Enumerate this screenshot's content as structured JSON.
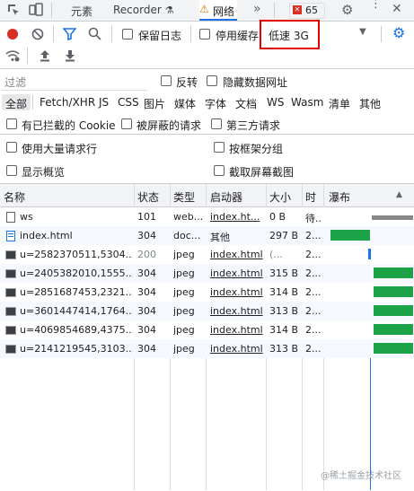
{
  "tabs": {
    "elements": "元素",
    "recorder": "Recorder",
    "network": "网络",
    "more": "»",
    "error_count": "65"
  },
  "toolbar": {
    "preserve_log": "保留日志",
    "disable_cache": "停用缓存",
    "throttling": "低速 3G"
  },
  "filter": {
    "placeholder": "过滤",
    "invert": "反转",
    "hide_data_urls": "隐藏数据网址",
    "types": [
      "全部",
      "Fetch/XHR",
      "JS",
      "CSS",
      "图片",
      "媒体",
      "字体",
      "文档",
      "WS",
      "Wasm",
      "清单",
      "其他"
    ],
    "blocked_cookies": "有已拦截的 Cookie",
    "blocked_requests": "被屏蔽的请求",
    "third_party": "第三方请求"
  },
  "settings": {
    "large_rows": "使用大量请求行",
    "group_by_frame": "按框架分组",
    "show_overview": "显示概览",
    "capture_screenshots": "截取屏幕截图"
  },
  "table": {
    "headers": [
      "名称",
      "状态",
      "类型",
      "启动器",
      "大小",
      "时",
      "瀑布"
    ],
    "rows": [
      {
        "name": "ws",
        "status": "101",
        "type": "web...",
        "initiator": "index.ht...",
        "size": "0 B",
        "time": "待...",
        "icon": "websocket-icon"
      },
      {
        "name": "index.html",
        "status": "304",
        "type": "doc...",
        "initiator": "其他",
        "size": "297 B",
        "time": "2...",
        "icon": "document-icon"
      },
      {
        "name": "u=2582370511,5304...",
        "status": "200",
        "type": "jpeg",
        "initiator": "index.html",
        "size": "(...",
        "time": "2...",
        "icon": "image-icon"
      },
      {
        "name": "u=2405382010,1555...",
        "status": "304",
        "type": "jpeg",
        "initiator": "index.html",
        "size": "315 B",
        "time": "2...",
        "icon": "image-icon"
      },
      {
        "name": "u=2851687453,2321...",
        "status": "304",
        "type": "jpeg",
        "initiator": "index.html",
        "size": "314 B",
        "time": "2...",
        "icon": "image-icon"
      },
      {
        "name": "u=3601447414,1764...",
        "status": "304",
        "type": "jpeg",
        "initiator": "index.html",
        "size": "313 B",
        "time": "2...",
        "icon": "image-icon"
      },
      {
        "name": "u=4069854689,4375...",
        "status": "304",
        "type": "jpeg",
        "initiator": "index.html",
        "size": "314 B",
        "time": "2...",
        "icon": "image-icon"
      },
      {
        "name": "u=2141219545,3103...",
        "status": "304",
        "type": "jpeg",
        "initiator": "index.html",
        "size": "313 B",
        "time": "2...",
        "icon": "image-icon"
      }
    ]
  },
  "watermark": "@稀土掘金技术社区",
  "colors": {
    "accent": "#1a73e8",
    "record": "#d93025",
    "highlight": "#e00000",
    "waterfall": "#1ca347"
  }
}
